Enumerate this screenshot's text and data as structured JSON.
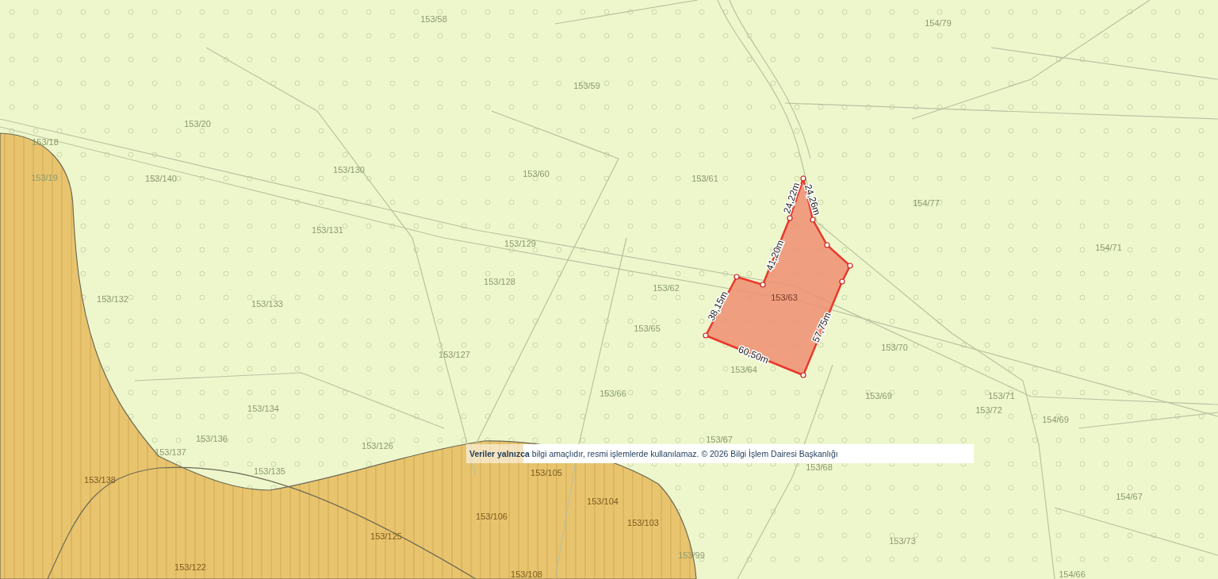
{
  "map": {
    "parcels": [
      {
        "label": "153/58"
      },
      {
        "label": "154/79"
      },
      {
        "label": "153/59"
      },
      {
        "label": "153/20"
      },
      {
        "label": "153/18"
      },
      {
        "label": "153/19"
      },
      {
        "label": "153/140"
      },
      {
        "label": "153/130"
      },
      {
        "label": "153/60"
      },
      {
        "label": "153/61"
      },
      {
        "label": "154/77"
      },
      {
        "label": "153/131"
      },
      {
        "label": "153/129"
      },
      {
        "label": "154/71"
      },
      {
        "label": "153/132"
      },
      {
        "label": "153/133"
      },
      {
        "label": "153/128"
      },
      {
        "label": "153/62"
      },
      {
        "label": "153/63"
      },
      {
        "label": "153/65"
      },
      {
        "label": "153/127"
      },
      {
        "label": "153/64"
      },
      {
        "label": "153/70"
      },
      {
        "label": "153/134"
      },
      {
        "label": "153/66"
      },
      {
        "label": "153/69"
      },
      {
        "label": "153/72"
      },
      {
        "label": "153/71"
      },
      {
        "label": "154/69"
      },
      {
        "label": "153/137"
      },
      {
        "label": "153/136"
      },
      {
        "label": "153/126"
      },
      {
        "label": "153/67"
      },
      {
        "label": "153/138"
      },
      {
        "label": "153/135"
      },
      {
        "label": "153/105"
      },
      {
        "label": "153/68"
      },
      {
        "label": "154/67"
      },
      {
        "label": "153/104"
      },
      {
        "label": "153/106"
      },
      {
        "label": "153/103"
      },
      {
        "label": "153/125"
      },
      {
        "label": "153/73"
      },
      {
        "label": "153/99"
      },
      {
        "label": "153/122"
      },
      {
        "label": "153/108"
      },
      {
        "label": "154/66"
      }
    ],
    "plot": {
      "edges": [
        {
          "length": "24,22m"
        },
        {
          "length": "24,26m"
        },
        {
          "length": "41,20m"
        },
        {
          "length": "38,15m"
        },
        {
          "length": "60,50m"
        },
        {
          "length": "57,75m"
        }
      ]
    },
    "disclaimer": "**Veriler yalnızca** bilgi amaçlıdır, resmi işlemlerde kullanılamaz. © 2026 Bilgi İşlem Dairesi Başkanlığı"
  }
}
